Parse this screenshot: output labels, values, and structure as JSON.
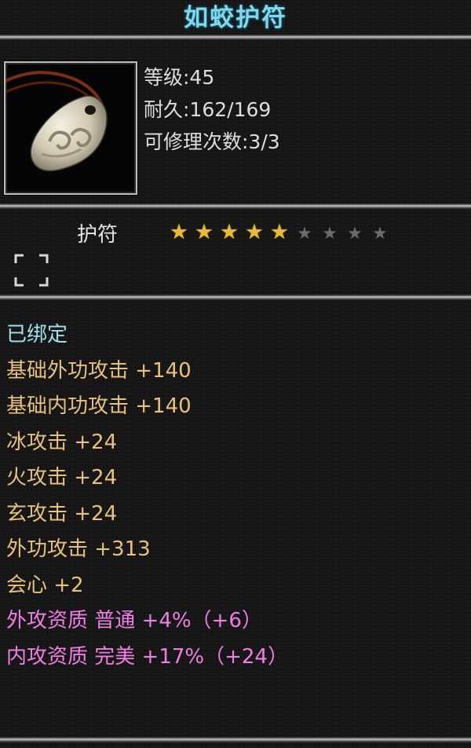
{
  "title": "如蛟护符",
  "item": {
    "icon": "jade-amulet-icon",
    "level": "等级:45",
    "durability": "耐久:162/169",
    "repairs": "可修理次数:3/3"
  },
  "type": {
    "label": "护符",
    "stars_filled": 5,
    "stars_total": 9
  },
  "attributes": [
    {
      "text": "已绑定",
      "color": "#9fe3ef"
    },
    {
      "text": "基础外功攻击 +140",
      "color": "#e8c27a"
    },
    {
      "text": "基础内功攻击 +140",
      "color": "#e8c27a"
    },
    {
      "text": "冰攻击 +24",
      "color": "#e8c27a"
    },
    {
      "text": "火攻击 +24",
      "color": "#e8c27a"
    },
    {
      "text": "玄攻击 +24",
      "color": "#e8c27a"
    },
    {
      "text": "外功攻击 +313",
      "color": "#e8c27a"
    },
    {
      "text": "会心 +2",
      "color": "#e8c27a"
    },
    {
      "text": "外攻资质  普通 +4%（+6）",
      "color": "#f07ee6"
    },
    {
      "text": "内攻资质  完美 +17%（+24）",
      "color": "#f07ee6"
    }
  ]
}
